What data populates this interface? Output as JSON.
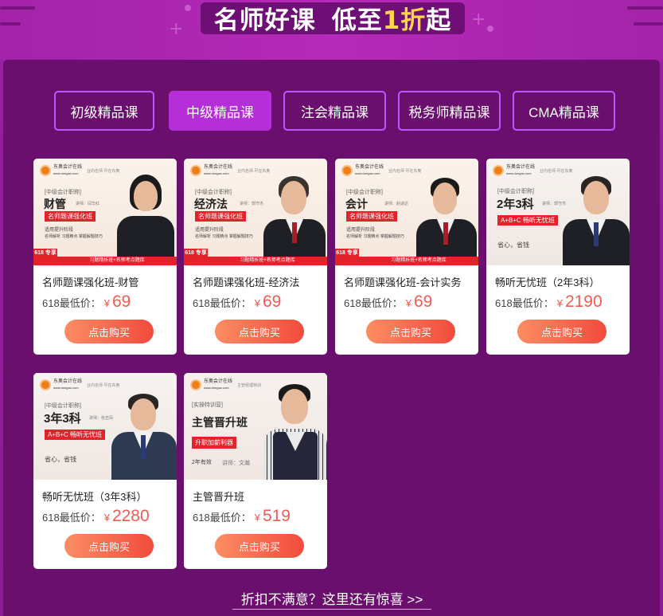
{
  "banner": {
    "title_part1": "名师好课",
    "title_part2": "低至",
    "title_highlight": "1折",
    "title_part3": "起"
  },
  "tabs": [
    {
      "label": "初级精品课",
      "active": false
    },
    {
      "label": "中级精品课",
      "active": true
    },
    {
      "label": "注会精品课",
      "active": false
    },
    {
      "label": "税务师精品课",
      "active": false
    },
    {
      "label": "CMA精品课",
      "active": false
    }
  ],
  "cards": [
    {
      "image": {
        "category": "[中级会计职称]",
        "subject": "财管",
        "lecturer": "讲师：闫华红",
        "red_label": "名师题课强化班",
        "line1": "适用提升阶段",
        "line2": "名师解析  习题精点  掌握解题技巧",
        "badge": "618 专享",
        "strip": "习题精析班+名师考点题库"
      },
      "title": "名师题课强化班-财管",
      "price_label": "618最低价：",
      "currency": "¥",
      "price": "69",
      "button": "点击购买"
    },
    {
      "image": {
        "category": "[中级会计职称]",
        "subject": "经济法",
        "lecturer": "讲师：郭守杰",
        "red_label": "名师题课强化班",
        "line1": "适用提升阶段",
        "line2": "名师解析  习题精点  掌握解题技巧",
        "badge": "618 专享",
        "strip": "习题精析班+名师考点题库"
      },
      "title": "名师题课强化班-经济法",
      "price_label": "618最低价：",
      "currency": "¥",
      "price": "69",
      "button": "点击购买"
    },
    {
      "image": {
        "category": "[中级会计职称]",
        "subject": "会计",
        "lecturer": "讲师：赵适达",
        "red_label": "名师题课强化班",
        "line1": "适用提升阶段",
        "line2": "名师解析  习题精点  掌握解题技巧",
        "badge": "618 专享",
        "strip": "习题精析班+名师考点题库"
      },
      "title": "名师题课强化班-会计实务",
      "price_label": "618最低价：",
      "currency": "¥",
      "price": "69",
      "button": "点击购买"
    },
    {
      "image": {
        "category": "[中级会计职称]",
        "subject": "2年3科",
        "lecturer": "讲师：郭守杰",
        "red_label": "A+B+C  畅听无忧班",
        "line1": "省心，省钱",
        "line2": "",
        "badge": "",
        "strip": ""
      },
      "title": "畅听无忧班（2年3科）",
      "price_label": "618最低价：",
      "currency": "¥",
      "price": "2190",
      "button": "点击购买"
    },
    {
      "image": {
        "category": "[中级会计职称]",
        "subject": "3年3科",
        "lecturer": "讲师：张志凤",
        "red_label": "A+B+C  畅听无忧班",
        "line1": "省心，省钱",
        "line2": "",
        "badge": "",
        "strip": ""
      },
      "title": "畅听无忧班（3年3科）",
      "price_label": "618最低价：",
      "currency": "¥",
      "price": "2280",
      "button": "点击购买"
    },
    {
      "image": {
        "category": "[实操特训营]",
        "subject": "主管晋升班",
        "lecturer": "讲师：文瀚",
        "red_label": "升职加薪利器",
        "line1": "2年有效",
        "line2": "",
        "badge": "",
        "strip": ""
      },
      "title": "主管晋升班",
      "price_label": "618最低价：",
      "currency": "¥",
      "price": "519",
      "button": "点击购买"
    }
  ],
  "brand": {
    "name": "东奥会计在线",
    "url": "www.dongao.com",
    "slogan": "业内名师  尽在东奥",
    "slogan_alt": "主管经理特训"
  },
  "more_link": "折扣不满意？这里还有惊喜 >>",
  "colors": {
    "accent": "#b42fd8",
    "price": "#f25b51",
    "panel": "#6b0f6e",
    "background": "#9b1fa6"
  }
}
